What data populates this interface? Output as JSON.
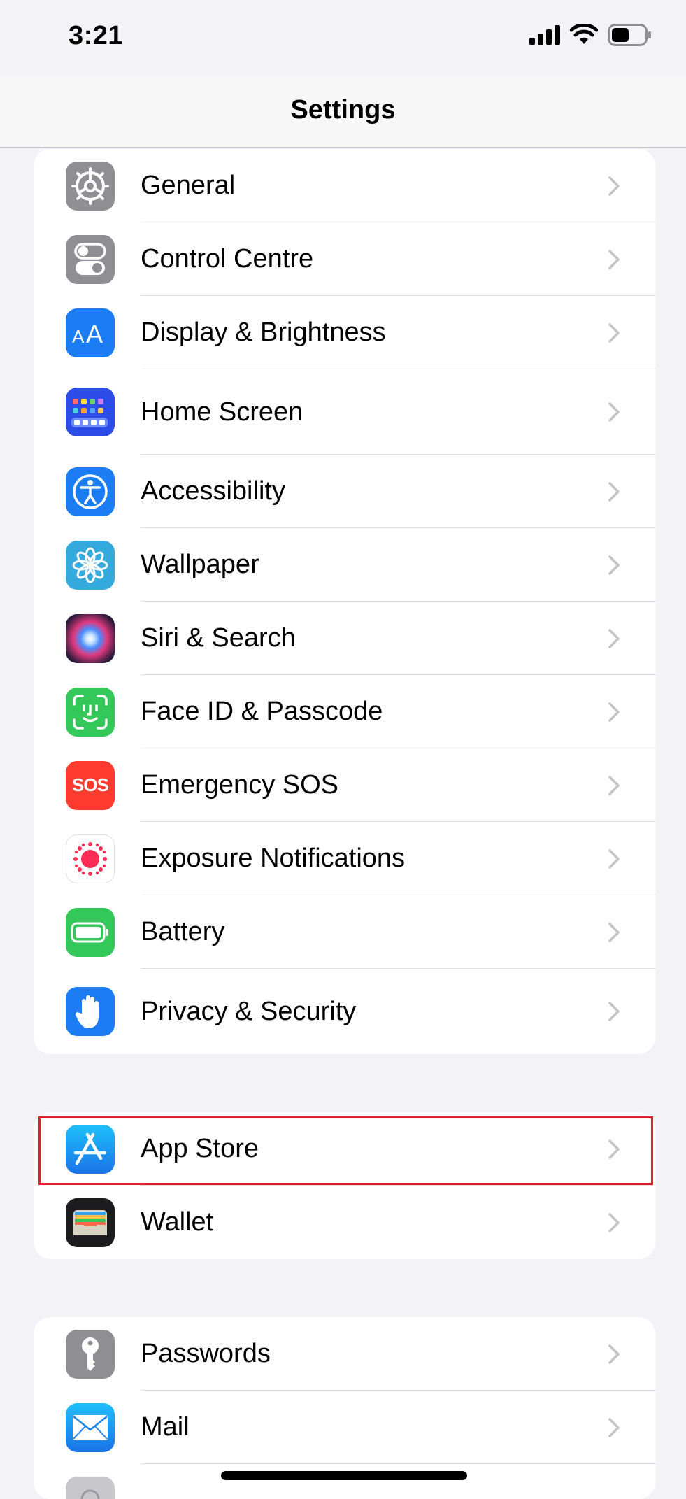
{
  "status_bar": {
    "time": "3:21"
  },
  "nav": {
    "title": "Settings"
  },
  "groups": [
    {
      "items": [
        {
          "label": "General",
          "icon": "gear-icon",
          "color": "#8e8e93"
        },
        {
          "label": "Control Centre",
          "icon": "toggles-icon",
          "color": "#8e8e93"
        },
        {
          "label": "Display & Brightness",
          "icon": "text-size-icon",
          "color": "#1c7cf4"
        },
        {
          "label": "Home Screen",
          "icon": "app-grid-icon",
          "color": "#2c4de8"
        },
        {
          "label": "Accessibility",
          "icon": "accessibility-icon",
          "color": "#1c7cf4"
        },
        {
          "label": "Wallpaper",
          "icon": "flower-icon",
          "color": "#35aadc"
        },
        {
          "label": "Siri & Search",
          "icon": "siri-icon",
          "color": "#222222"
        },
        {
          "label": "Face ID & Passcode",
          "icon": "face-id-icon",
          "color": "#34c759"
        },
        {
          "label": "Emergency SOS",
          "icon": "sos-icon",
          "color": "#ff3b30",
          "icon_text": "SOS"
        },
        {
          "label": "Exposure Notifications",
          "icon": "exposure-icon",
          "color": "#ffffff"
        },
        {
          "label": "Battery",
          "icon": "battery-icon",
          "color": "#34c759"
        },
        {
          "label": "Privacy & Security",
          "icon": "hand-icon",
          "color": "#1c7cf4"
        }
      ]
    },
    {
      "items": [
        {
          "label": "App Store",
          "icon": "app-store-icon",
          "color": "#1c8ef4"
        },
        {
          "label": "Wallet",
          "icon": "wallet-icon",
          "color": "#1c1c1e"
        }
      ]
    },
    {
      "items": [
        {
          "label": "Passwords",
          "icon": "key-icon",
          "color": "#8e8e93"
        },
        {
          "label": "Mail",
          "icon": "mail-icon",
          "color": "#2196f3"
        },
        {
          "label": "",
          "icon": "contacts-icon",
          "color": "#c7c7cc"
        }
      ]
    }
  ]
}
